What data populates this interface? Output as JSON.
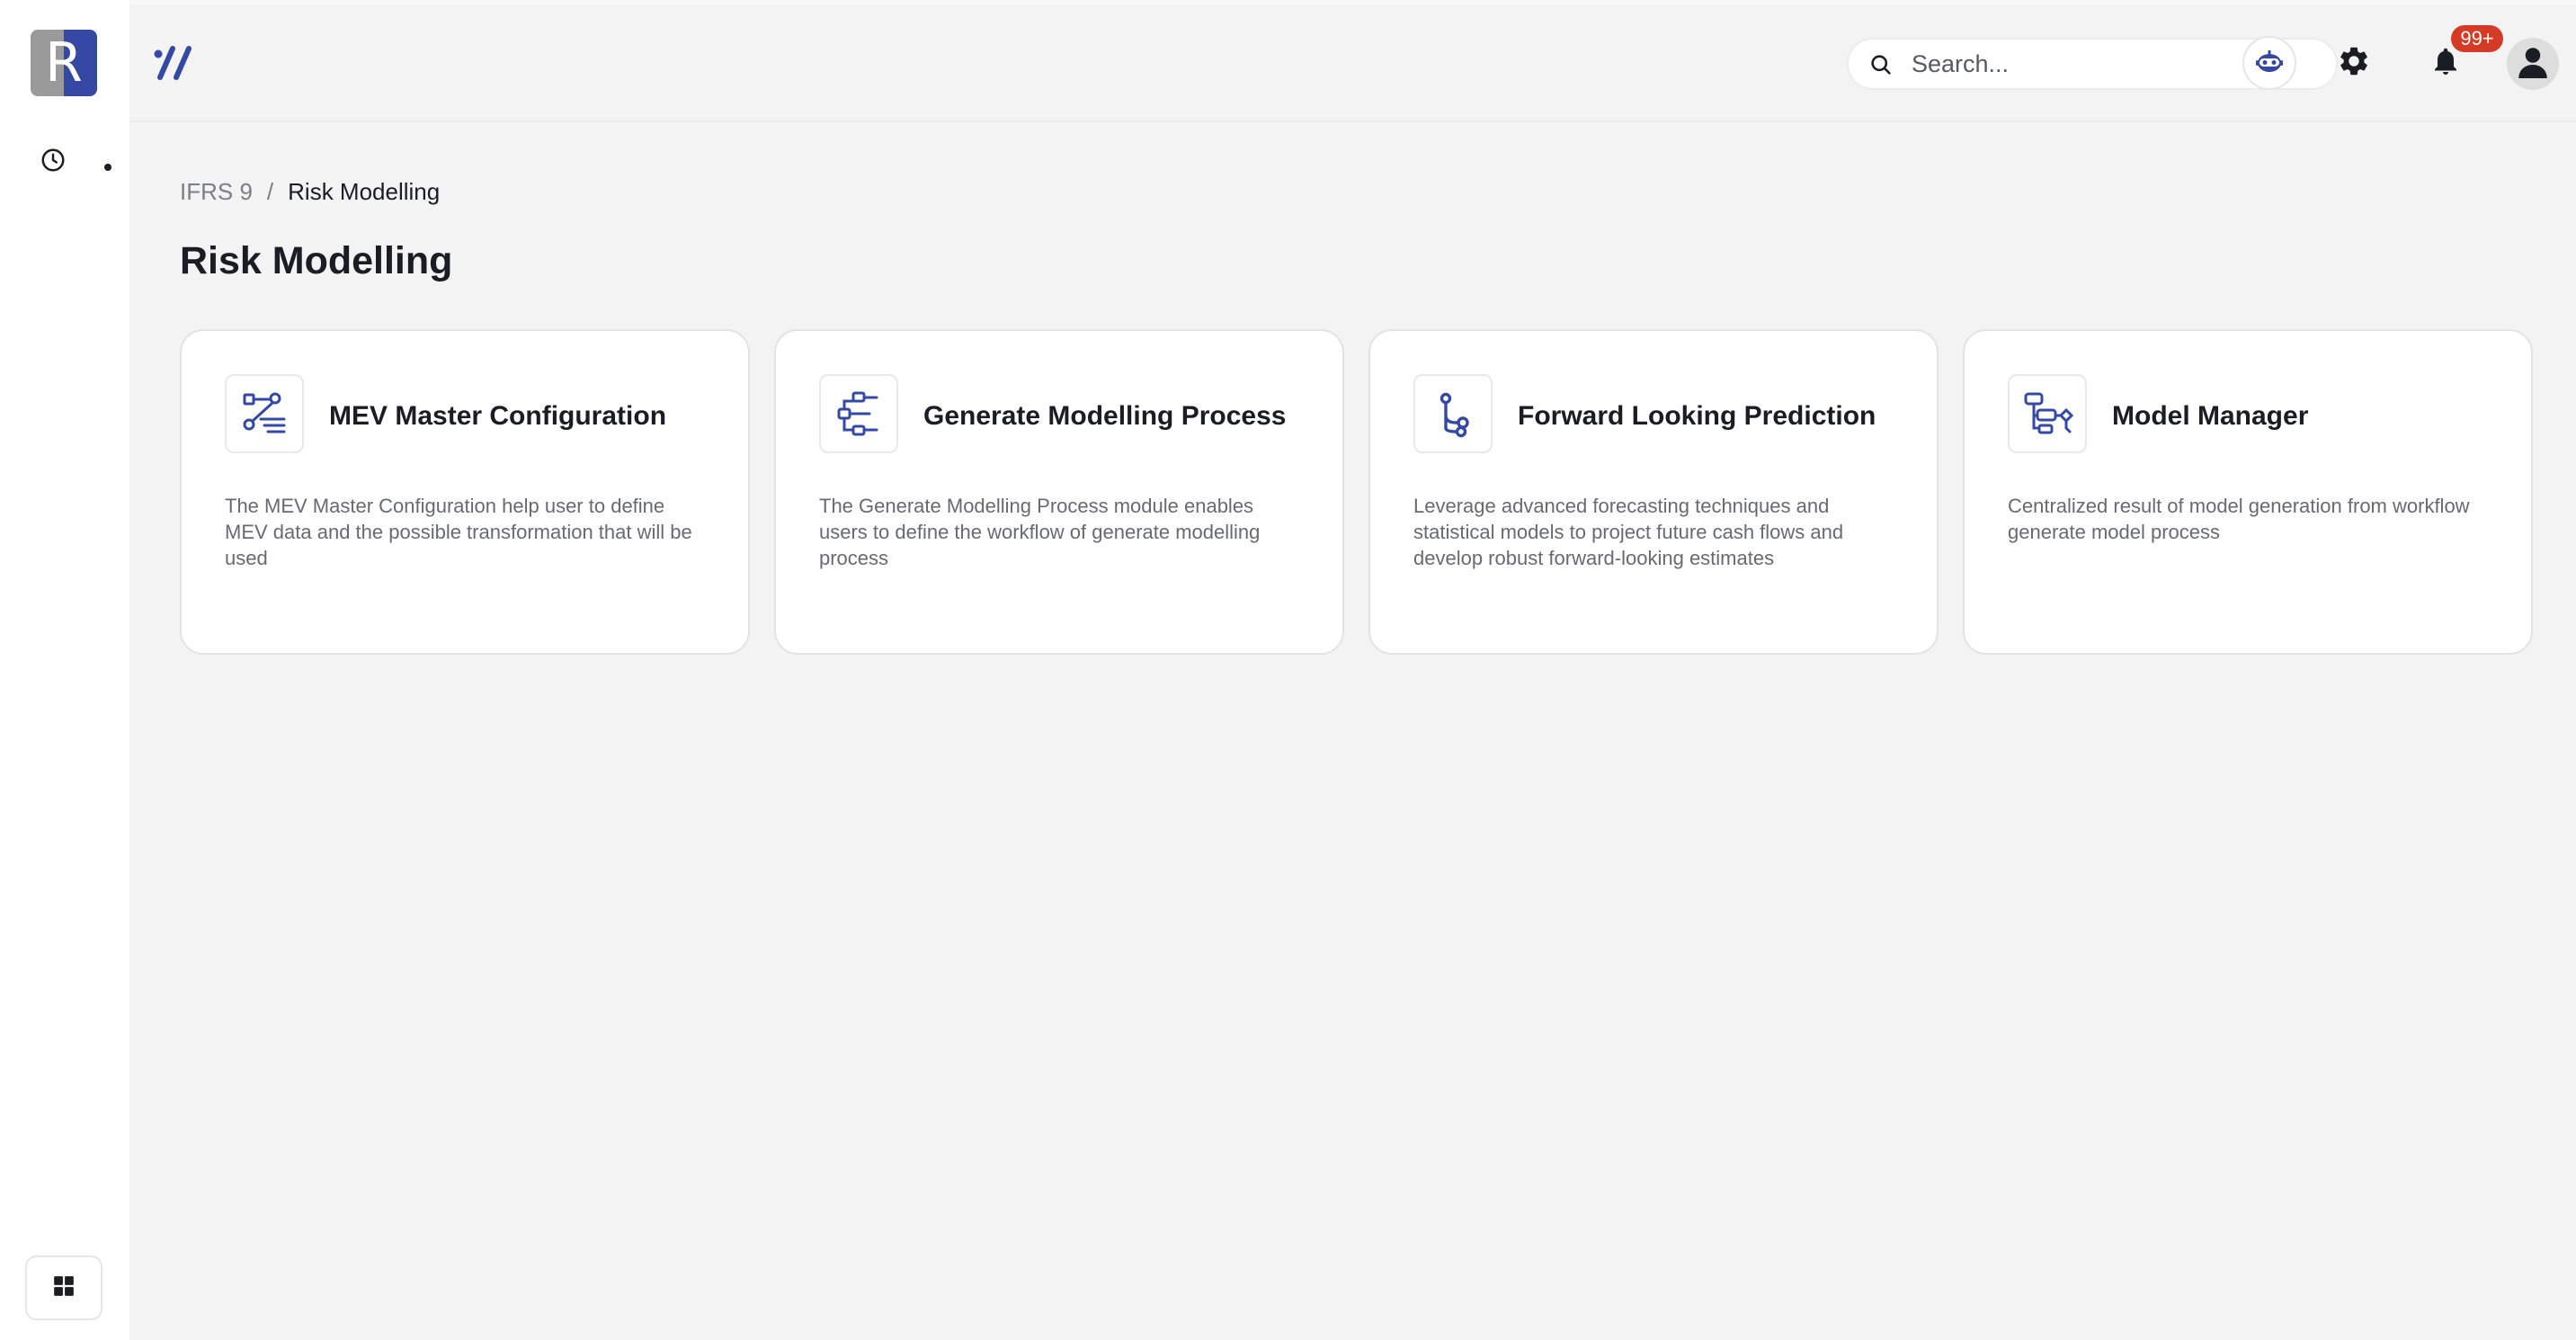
{
  "app": {
    "logo_letter": "R",
    "brand_colors": {
      "primary": "#3549a4",
      "logo_left": "#9a9a9a",
      "badge": "#d43a25"
    }
  },
  "sidebar": {
    "history_icon": "clock-icon",
    "apps_icon": "grid-icon"
  },
  "topbar": {
    "brand_icon": "slashes-icon",
    "search": {
      "placeholder": "Search...",
      "value": ""
    },
    "assistant_icon": "robot-icon",
    "settings_icon": "gear-icon",
    "notifications": {
      "icon": "bell-icon",
      "badge": "99+"
    },
    "profile_icon": "user-icon"
  },
  "breadcrumb": {
    "items": [
      "IFRS 9",
      "Risk Modelling"
    ],
    "separator": "/"
  },
  "page": {
    "title": "Risk Modelling"
  },
  "cards": [
    {
      "icon": "workflow-list-icon",
      "title": "MEV Master Configuration",
      "description": "The MEV Master Configuration help user to define MEV data and the possible transformation that will be used"
    },
    {
      "icon": "process-flow-icon",
      "title": "Generate Modelling Process",
      "description": "The Generate Modelling Process module enables users to define the workflow of generate modelling process"
    },
    {
      "icon": "branch-icon",
      "title": "Forward Looking Prediction",
      "description": "Leverage advanced forecasting techniques and statistical models to project future cash flows and develop robust forward-looking estimates"
    },
    {
      "icon": "model-structure-icon",
      "title": "Model Manager",
      "description": "Centralized result of model generation from workflow generate model process"
    }
  ]
}
